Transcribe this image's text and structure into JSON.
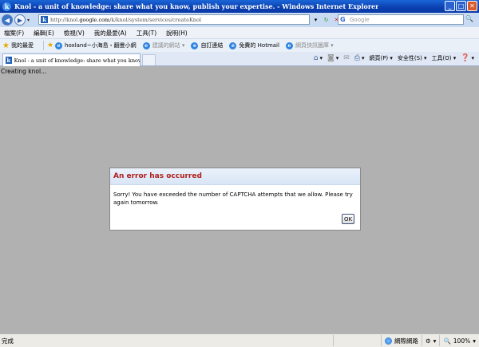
{
  "window": {
    "title": "Knol - a unit of knowledge: share what you know, publish your expertise. - Windows Internet Explorer",
    "controls": [
      "_",
      "□",
      "✕"
    ]
  },
  "address_bar": {
    "url_prefix": "http://knol.",
    "url_domain": "google.com",
    "url_path": "/k/knol/system/services/createKnol",
    "search_placeholder": "Google"
  },
  "menu": {
    "items": [
      "檔案(F)",
      "編輯(E)",
      "檢視(V)",
      "我的最愛(A)",
      "工具(T)",
      "說明(H)"
    ]
  },
  "favorites_bar": {
    "favorites_label": "我的最愛",
    "items": [
      {
        "label": "hoxland~小海島・翻曼小網",
        "dim": false
      },
      {
        "label": "建議的網站 ▾",
        "dim": true
      },
      {
        "label": "自訂連結",
        "dim": false
      },
      {
        "label": "免費的 Hotmail",
        "dim": false
      },
      {
        "label": "網頁快訊圖庫 ▾",
        "dim": true
      }
    ]
  },
  "tabs": {
    "active_tab": "Knol - a unit of knowledge: share what you know, publi...",
    "commands": [
      "網頁(P) ▾",
      "安全性(S) ▾",
      "工具(O) ▾"
    ]
  },
  "page": {
    "loading_text": "Creating knol...",
    "dialog": {
      "title": "An error has occurred",
      "message": "Sorry! You have exceeded the number of CAPTCHA attempts that we allow. Please try again tomorrow.",
      "ok_label": "OK"
    }
  },
  "status_bar": {
    "status": "完成",
    "zone": "網際網路",
    "zoom": "100%"
  },
  "colors": {
    "titlebar": "#0a3fb0",
    "error_title": "#b0201c",
    "page_background": "#b1b1b1"
  }
}
